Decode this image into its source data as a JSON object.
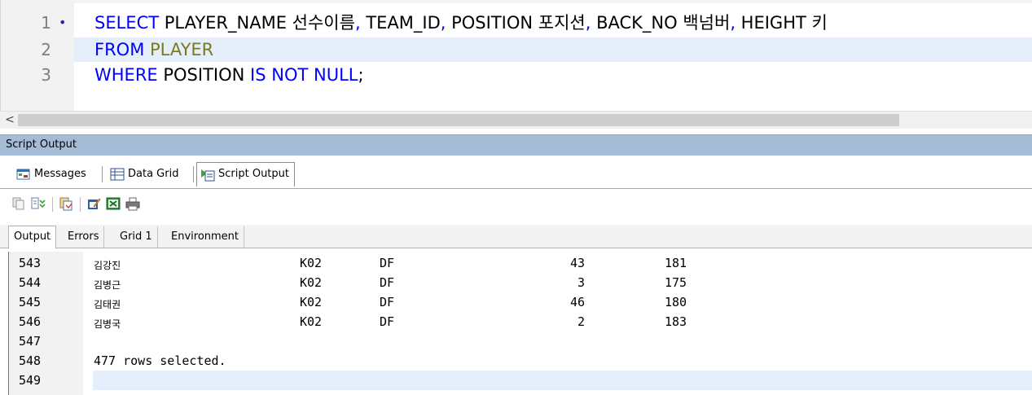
{
  "editor": {
    "line_numbers": [
      "1",
      "2",
      "3"
    ],
    "fold_marker": "•",
    "line1": {
      "kw_select": "SELECT",
      "col1": " PLAYER_NAME 선수이름",
      "c1": ",",
      "col2": " TEAM_ID",
      "c2": ",",
      "col3": " POSITION 포지션",
      "c3": ",",
      "col4": " BACK_NO 백넘버",
      "c4": ",",
      "col5": " HEIGHT 키"
    },
    "line2": {
      "kw_from": "FROM",
      "table": " PLAYER"
    },
    "line3": {
      "kw_where": "WHERE",
      "text1": " POSITION ",
      "kw_is": "IS",
      "sp": " ",
      "kw_not": "NOT",
      "sp2": " ",
      "kw_null": "NULL",
      "semi": ";"
    },
    "scroll_left": "<"
  },
  "panel": {
    "title": "Script Output",
    "subtabs": [
      "Messages",
      "Data Grid",
      "Script Output"
    ],
    "tabs": [
      "Output",
      "Errors",
      "Grid 1",
      "Environment"
    ]
  },
  "toolbar_icons": [
    "copy-icon",
    "find-icon",
    "paste-icon",
    "edit-icon",
    "excel-icon",
    "print-icon"
  ],
  "output": {
    "rows": [
      {
        "num": "543",
        "name": "김강진",
        "team": "K02",
        "pos": "DF",
        "back": "43",
        "height": "181"
      },
      {
        "num": "544",
        "name": "김병근",
        "team": "K02",
        "pos": "DF",
        "back": "3",
        "height": "175"
      },
      {
        "num": "545",
        "name": "김태권",
        "team": "K02",
        "pos": "DF",
        "back": "46",
        "height": "180"
      },
      {
        "num": "546",
        "name": "김병국",
        "team": "K02",
        "pos": "DF",
        "back": "2",
        "height": "183"
      }
    ],
    "blank_num": "547",
    "message_num": "548",
    "message": "477 rows selected.",
    "last_num": "549"
  }
}
